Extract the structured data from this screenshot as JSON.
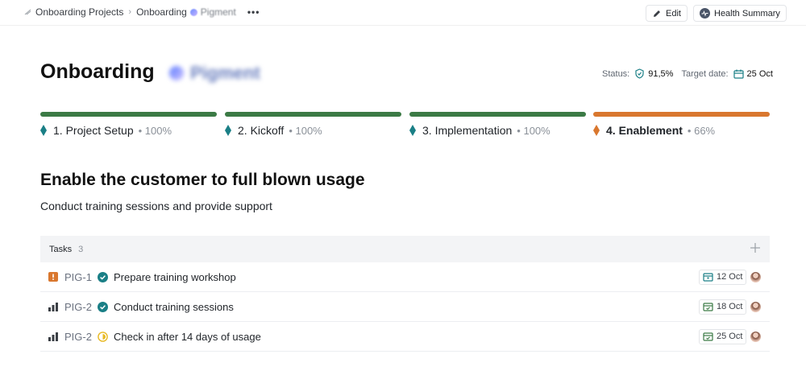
{
  "breadcrumb": {
    "items": [
      "Onboarding Projects",
      "Onboarding"
    ],
    "blurred_client": "Pigment",
    "more": "•••"
  },
  "toolbar": {
    "edit_label": "Edit",
    "health_label": "Health Summary"
  },
  "header": {
    "title": "Onboarding",
    "blurred_client": "Pigment",
    "status_label": "Status:",
    "status_value": "91,5%",
    "target_label": "Target date:",
    "target_value": "25 Oct"
  },
  "phases": [
    {
      "name": "1. Project Setup",
      "pct": "• 100%",
      "progress": 1.0,
      "color": "#3b7a45"
    },
    {
      "name": "2. Kickoff",
      "pct": "• 100%",
      "progress": 1.0,
      "color": "#3b7a45"
    },
    {
      "name": "3. Implementation",
      "pct": "• 100%",
      "progress": 1.0,
      "color": "#3b7a45"
    },
    {
      "name": "4. Enablement",
      "pct": "• 66%",
      "progress": 0.66,
      "color": "#d9772e"
    }
  ],
  "section": {
    "title": "Enable the customer to full blown usage",
    "subtitle": "Conduct training sessions and provide support"
  },
  "tasks": {
    "label": "Tasks",
    "count": "3",
    "rows": [
      {
        "priority": "urgent-icon",
        "key": "PIG-1",
        "status": "done-icon",
        "name": "Prepare training workshop",
        "date": "12 Oct"
      },
      {
        "priority": "priority-bars-icon",
        "key": "PIG-2",
        "status": "done-icon",
        "name": "Conduct training sessions",
        "date": "18 Oct"
      },
      {
        "priority": "priority-bars-icon",
        "key": "PIG-2",
        "status": "in-progress-icon",
        "name": "Check in after 14 days of usage",
        "date": "25 Oct"
      }
    ]
  },
  "colors": {
    "complete": "#3b7a45",
    "active": "#d9772e",
    "teal": "#1a7f86"
  }
}
